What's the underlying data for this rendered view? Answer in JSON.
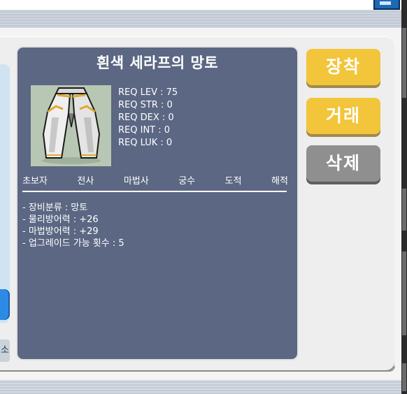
{
  "window": {
    "left_button_label": "소"
  },
  "item": {
    "name": "흰색 세라프의 망토",
    "icon": "white-cape-icon",
    "requirements": [
      "REQ LEV : 75",
      "REQ STR : 0",
      "REQ DEX : 0",
      "REQ INT : 0",
      "REQ LUK : 0"
    ],
    "jobs": [
      "초보자",
      "전사",
      "마법사",
      "궁수",
      "도적",
      "해적"
    ],
    "stats": [
      "- 장비분류 : 망토",
      "- 물리방어력 : +26",
      "- 마법방어력 : +29",
      "- 업그레이드 가능 횟수 : 5"
    ]
  },
  "actions": {
    "equip_label": "장착",
    "trade_label": "거래",
    "delete_label": "삭제"
  },
  "colors": {
    "card_bg": "#5b6783",
    "button_yellow": "#f2c53a",
    "button_gray": "#8f8f8f",
    "scroll_thumb": "#2d8be6"
  }
}
